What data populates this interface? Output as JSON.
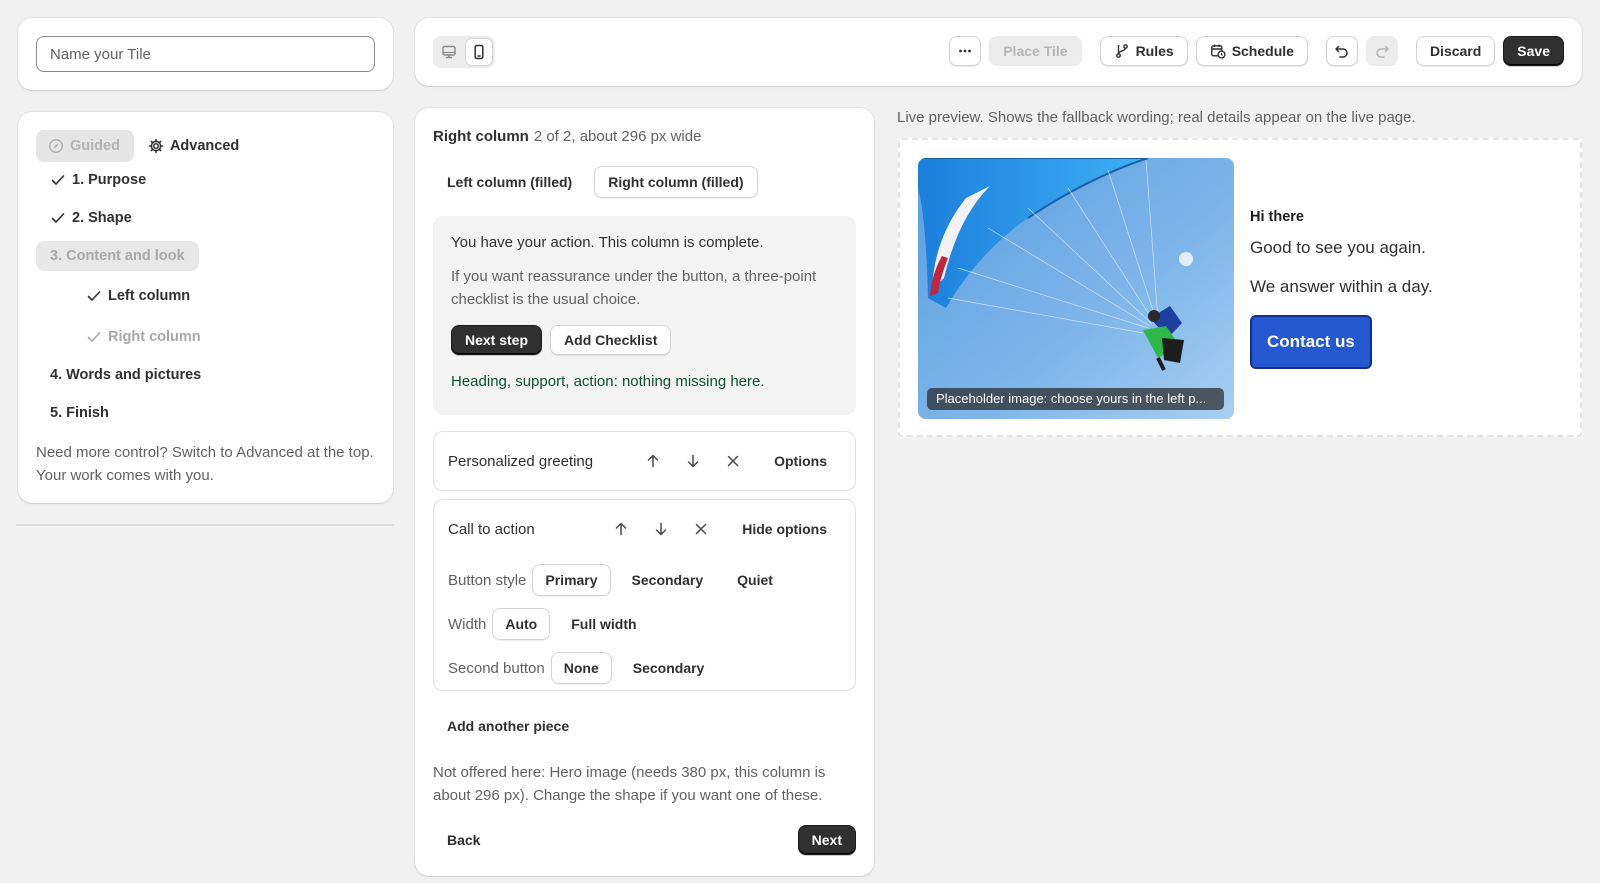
{
  "name_field": {
    "placeholder": "Name your Tile",
    "value": ""
  },
  "mode": {
    "guided": "Guided",
    "advanced": "Advanced"
  },
  "steps": {
    "s1": "1. Purpose",
    "s2": "2. Shape",
    "s3": "3. Content and look",
    "s3a": "Left column",
    "s3b": "Right column",
    "s4": "4. Words and pictures",
    "s5": "5. Finish",
    "help": "Need more control? Switch to Advanced at the top. Your work comes with you."
  },
  "toolbar": {
    "place_tile": "Place Tile",
    "rules": "Rules",
    "schedule": "Schedule",
    "discard": "Discard",
    "save": "Save"
  },
  "editor": {
    "column_title": "Right column",
    "column_meta": "2 of 2, about 296 px wide",
    "tabs": [
      "Left column (filled)",
      "Right column (filled)"
    ],
    "status": {
      "line1": "You have your action. This column is complete.",
      "line2": "If you want reassurance under the button, a three-point checklist is the usual choice.",
      "next_step": "Next step",
      "add_checklist": "Add Checklist",
      "ok": "Heading, support, action: nothing missing here."
    },
    "pieces": {
      "greeting": {
        "title": "Personalized greeting",
        "options": "Options"
      },
      "cta": {
        "title": "Call to action",
        "hide_options": "Hide options",
        "button_style_label": "Button style",
        "button_style_options": [
          "Primary",
          "Secondary",
          "Quiet"
        ],
        "width_label": "Width",
        "width_options": [
          "Auto",
          "Full width"
        ],
        "second_button_label": "Second button",
        "second_button_options": [
          "None",
          "Secondary"
        ]
      }
    },
    "add_piece": "Add another piece",
    "not_offered": "Not offered here: Hero image (needs 380 px, this column is about 296 px). Change the shape if you want one of these.",
    "back": "Back",
    "next": "Next"
  },
  "preview": {
    "note": "Live preview. Shows the fallback wording; real details appear on the live page.",
    "image_caption": "Placeholder image: choose yours in the left p...",
    "greeting": "Hi there",
    "line1": "Good to see you again.",
    "line2": "We answer within a day.",
    "cta": "Contact us",
    "cta_color": "#2558d0"
  }
}
